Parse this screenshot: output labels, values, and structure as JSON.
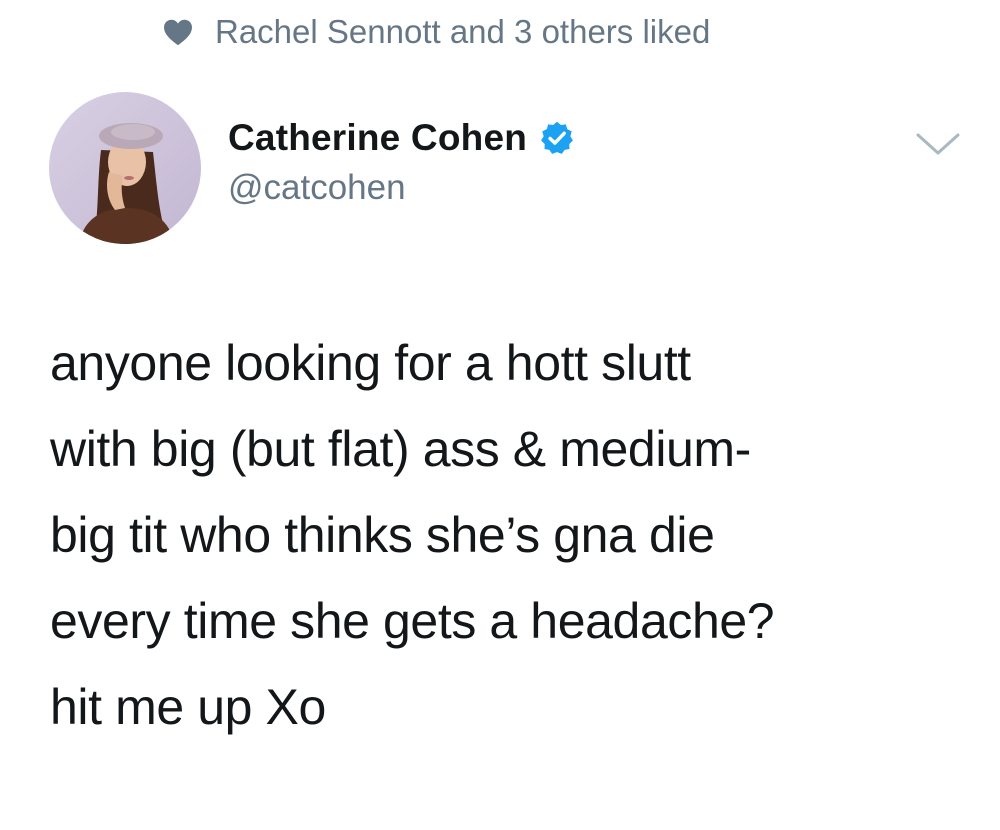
{
  "social_context": {
    "icon": "heart-icon",
    "text": "Rachel Sennott and 3 others liked"
  },
  "author": {
    "name": "Catherine Cohen",
    "handle": "@catcohen",
    "verified_icon": "verified-badge-icon",
    "avatar_icon": "avatar"
  },
  "menu": {
    "icon": "chevron-down-icon"
  },
  "tweet": {
    "lines": [
      "anyone looking for a hott slutt",
      "with big (but flat) ass & medium-",
      "big tit who thinks she’s gna die",
      "every time she gets a headache?",
      "hit me up Xo"
    ]
  },
  "colors": {
    "text_primary": "#14171a",
    "text_secondary": "#657786",
    "verified_blue": "#1da1f2",
    "heart_gray": "#657786"
  }
}
